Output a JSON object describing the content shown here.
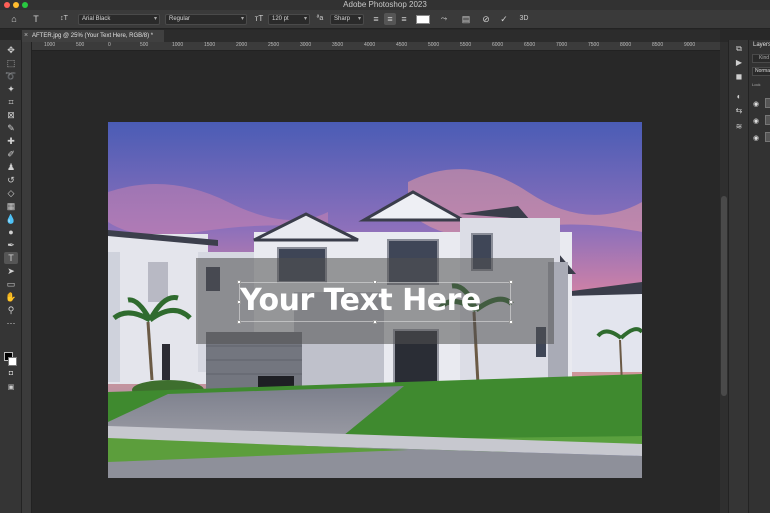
{
  "window": {
    "title": "Adobe Photoshop 2023"
  },
  "options_bar": {
    "font_family": "Arial Black",
    "font_style": "Regular",
    "font_size": "120 pt",
    "antialias": "Sharp"
  },
  "document_tab": {
    "label": "AFTER.jpg @ 25% (Your Text Here, RGB/8) *"
  },
  "ruler": {
    "labels": [
      "1000",
      "500",
      "0",
      "500",
      "1000",
      "1500",
      "2000",
      "2500",
      "3000",
      "3500",
      "4000",
      "4500",
      "5000",
      "5500",
      "6000",
      "6500",
      "7000",
      "7500",
      "8000",
      "8500",
      "9000"
    ]
  },
  "canvas": {
    "overlay_text": "Your Text Here"
  },
  "layers_panel": {
    "title": "Layers",
    "kind_placeholder": "Kind",
    "blend_mode": "Normal",
    "lock_label": "Lock"
  },
  "colors": {
    "foreground": "#000000",
    "background": "#ffffff",
    "text_color": "#ffffff",
    "app_bg": "#282828"
  },
  "icons": {
    "toolbar": [
      "move-icon",
      "marquee-icon",
      "lasso-icon",
      "magic-wand-icon",
      "crop-icon",
      "frame-icon",
      "eyedropper-icon",
      "healing-icon",
      "brush-icon",
      "stamp-icon",
      "history-brush-icon",
      "eraser-icon",
      "gradient-icon",
      "blur-icon",
      "dodge-icon",
      "pen-icon",
      "type-icon",
      "path-select-icon",
      "rectangle-icon",
      "hand-icon",
      "zoom-icon",
      "more-icon"
    ]
  }
}
